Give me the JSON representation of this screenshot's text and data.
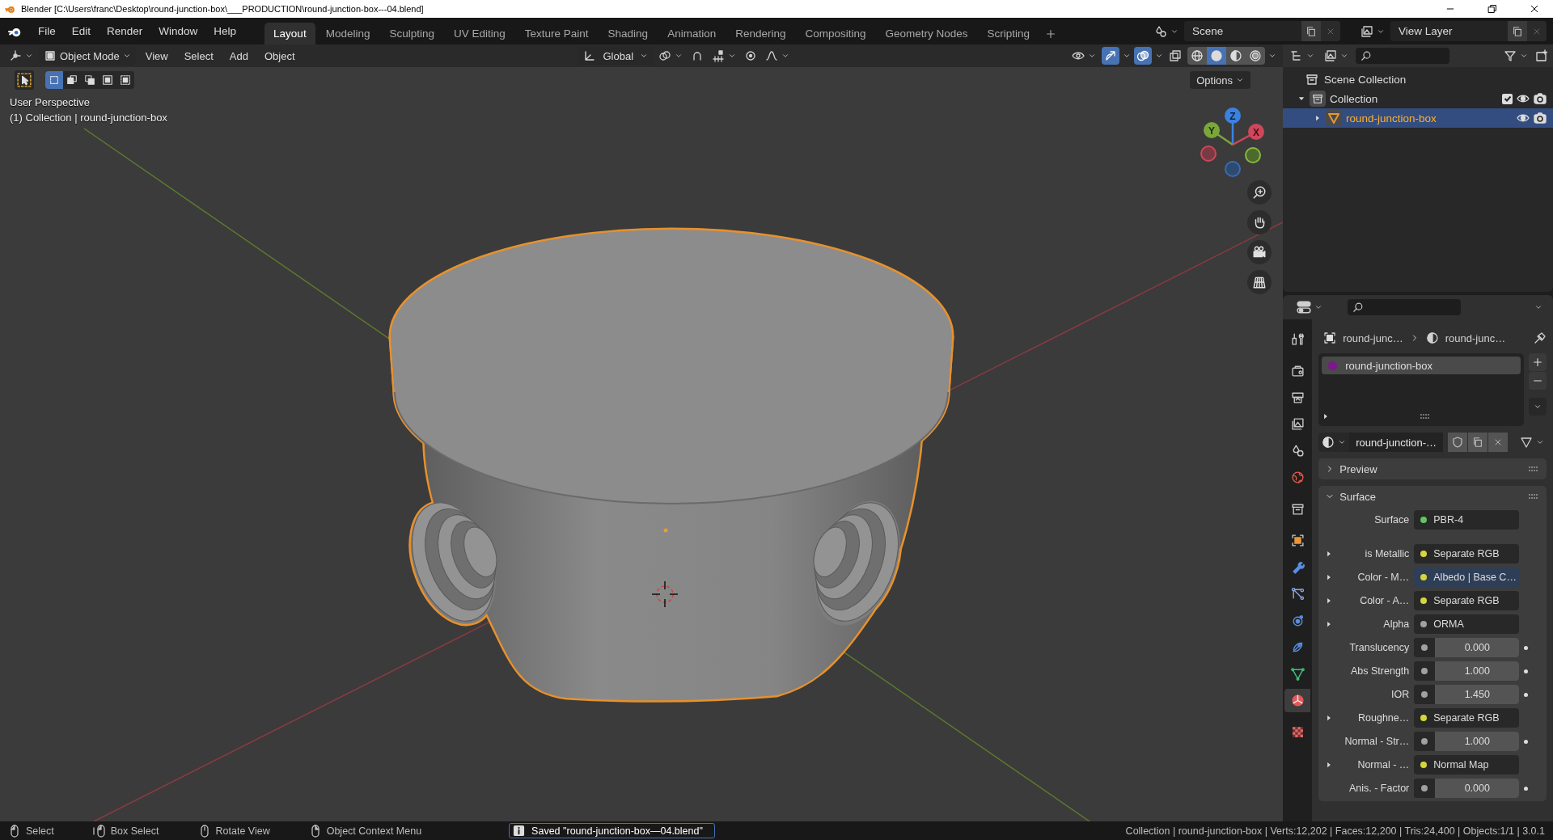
{
  "window": {
    "title": "Blender [C:\\Users\\franc\\Desktop\\round-junction-box\\___PRODUCTION\\round-junction-box---04.blend]"
  },
  "menu": [
    "File",
    "Edit",
    "Render",
    "Window",
    "Help"
  ],
  "workspaces": [
    {
      "label": "Layout",
      "selected": true
    },
    {
      "label": "Modeling",
      "selected": false
    },
    {
      "label": "Sculpting",
      "selected": false
    },
    {
      "label": "UV Editing",
      "selected": false
    },
    {
      "label": "Texture Paint",
      "selected": false
    },
    {
      "label": "Shading",
      "selected": false
    },
    {
      "label": "Animation",
      "selected": false
    },
    {
      "label": "Rendering",
      "selected": false
    },
    {
      "label": "Compositing",
      "selected": false
    },
    {
      "label": "Geometry Nodes",
      "selected": false
    },
    {
      "label": "Scripting",
      "selected": false
    }
  ],
  "scene": {
    "name": "Scene"
  },
  "view_layer": {
    "name": "View Layer"
  },
  "viewport": {
    "mode": "Object Mode",
    "menus": [
      "View",
      "Select",
      "Add",
      "Object"
    ],
    "orientation": "Global",
    "toggles": [
      {
        "kind": "gizmos",
        "on": true
      },
      {
        "kind": "overlays",
        "on": true
      },
      {
        "kind": "xray",
        "on": false
      }
    ],
    "shading": [
      {
        "kind": "wireframe",
        "selected": false
      },
      {
        "kind": "solid",
        "selected": true
      },
      {
        "kind": "material",
        "selected": false
      },
      {
        "kind": "rendered",
        "selected": false
      }
    ],
    "select_modes": [
      {
        "selected": true
      },
      {
        "selected": false
      },
      {
        "selected": false
      },
      {
        "selected": false
      },
      {
        "selected": false
      }
    ],
    "options": "Options",
    "view_name": "User Perspective",
    "context": "(1) Collection | round-junction-box",
    "gizmo": [
      "Z",
      "Y",
      "X"
    ]
  },
  "outliner": {
    "root": "Scene Collection",
    "items": [
      {
        "label": "Collection",
        "expanded": true,
        "checked": true,
        "selected": false,
        "children": [
          {
            "label": "round-junction-box",
            "expanded": false,
            "selected": true
          }
        ]
      }
    ]
  },
  "properties": {
    "breadcrumb": [
      "round-junc…",
      "round-junc…"
    ],
    "tabs": [
      {
        "kind": "tool",
        "selected": false
      },
      {
        "kind": "render",
        "selected": false
      },
      {
        "kind": "output",
        "selected": false
      },
      {
        "kind": "view_layer",
        "selected": false
      },
      {
        "kind": "scene",
        "selected": false
      },
      {
        "kind": "world",
        "selected": false
      },
      {
        "kind": "collection",
        "selected": false
      },
      {
        "kind": "object",
        "selected": false
      },
      {
        "kind": "modifiers",
        "selected": false
      },
      {
        "kind": "particles",
        "selected": false
      },
      {
        "kind": "physics",
        "selected": false
      },
      {
        "kind": "constraints",
        "selected": false
      },
      {
        "kind": "data",
        "selected": false
      },
      {
        "kind": "material",
        "selected": true
      },
      {
        "kind": "texture",
        "selected": false
      }
    ],
    "slots": [
      {
        "label": "round-junction-box",
        "selected": true
      }
    ],
    "material": "round-junction-…",
    "panels": [
      {
        "label": "Preview",
        "expanded": false
      },
      {
        "label": "Surface",
        "expanded": true
      }
    ],
    "inputs": [
      {
        "label": "Surface",
        "kind": "link",
        "value": "PBR-4",
        "color": "#62c462",
        "expandable": false,
        "highlighted": false
      },
      {
        "label": "is Metallic",
        "kind": "link",
        "value": "Separate RGB",
        "color": "#d6d63a",
        "expandable": true,
        "highlighted": false
      },
      {
        "label": "Color - M…",
        "kind": "link",
        "value": "Albedo | Base C…",
        "color": "#d6d63a",
        "expandable": true,
        "highlighted": true
      },
      {
        "label": "Color - A…",
        "kind": "link",
        "value": "Separate RGB",
        "color": "#d6d63a",
        "expandable": true,
        "highlighted": false
      },
      {
        "label": "Alpha",
        "kind": "link",
        "value": "ORMA",
        "color": "#a1a1a1",
        "expandable": true,
        "highlighted": false
      },
      {
        "label": "Translucency",
        "kind": "value",
        "value": "0.000",
        "color": "#a1a1a1",
        "expandable": false,
        "highlighted": false
      },
      {
        "label": "Abs Strength",
        "kind": "value",
        "value": "1.000",
        "color": "#a1a1a1",
        "expandable": false,
        "highlighted": false
      },
      {
        "label": "IOR",
        "kind": "value",
        "value": "1.450",
        "color": "#a1a1a1",
        "expandable": false,
        "highlighted": false
      },
      {
        "label": "Roughne…",
        "kind": "link",
        "value": "Separate RGB",
        "color": "#d6d63a",
        "expandable": true,
        "highlighted": false
      },
      {
        "label": "Normal - Str…",
        "kind": "value",
        "value": "1.000",
        "color": "#a1a1a1",
        "expandable": false,
        "highlighted": false
      },
      {
        "label": "Normal - …",
        "kind": "link",
        "value": "Normal Map",
        "color": "#d6d63a",
        "expandable": true,
        "highlighted": false
      },
      {
        "label": "Anis. - Factor",
        "kind": "value",
        "value": "0.000",
        "color": "#a1a1a1",
        "expandable": false,
        "highlighted": false
      }
    ]
  },
  "status_bar": {
    "hints": [
      {
        "kind": "left",
        "label": "Select"
      },
      {
        "kind": "drag",
        "label": "Box Select"
      },
      {
        "kind": "middle",
        "label": "Rotate View"
      },
      {
        "kind": "right",
        "label": "Object Context Menu"
      }
    ],
    "message": "Saved \"round-junction-box—04.blend\"",
    "stats": "Collection | round-junction-box | Verts:12,202 | Faces:12,200 | Tris:24,400 | Objects:1/1 | 3.0.1"
  }
}
